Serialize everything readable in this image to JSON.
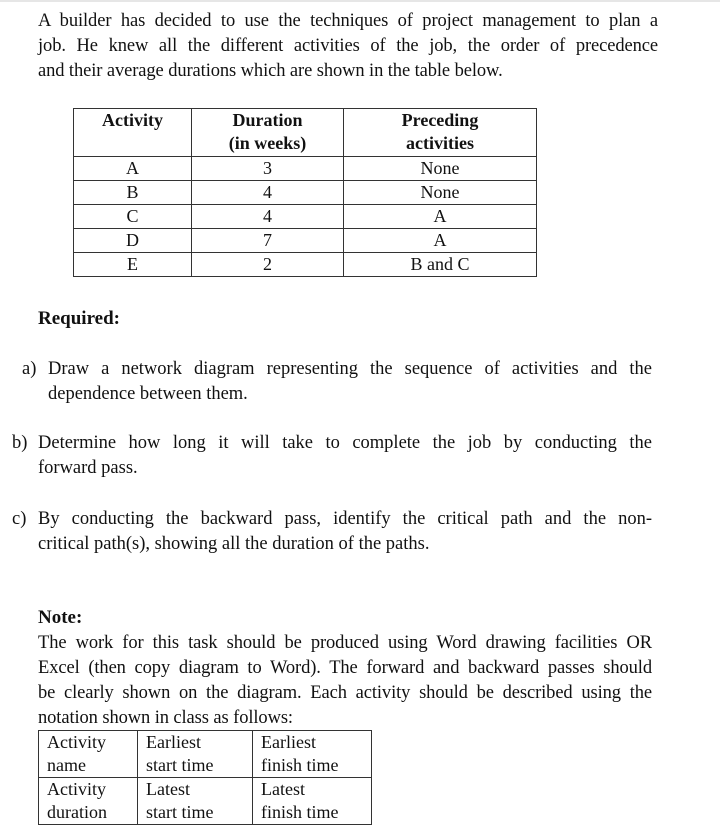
{
  "intro": {
    "lines": [
      "A builder has decided to use the techniques of project management to plan a",
      "job. He knew all the different activities of the job, the order of precedence",
      "and their average durations which are shown in the table below."
    ]
  },
  "activity_table": {
    "headers": [
      "Activity",
      "Duration (in weeks)",
      "Preceding activities"
    ],
    "header_lines": [
      [
        "Activity"
      ],
      [
        "Duration",
        "(in weeks)"
      ],
      [
        "Preceding",
        "activities"
      ]
    ],
    "rows": [
      {
        "activity": "A",
        "duration": "3",
        "preceding": "None"
      },
      {
        "activity": "B",
        "duration": "4",
        "preceding": "None"
      },
      {
        "activity": "C",
        "duration": "4",
        "preceding": "A"
      },
      {
        "activity": "D",
        "duration": "7",
        "preceding": "A"
      },
      {
        "activity": "E",
        "duration": "2",
        "preceding": "B and C"
      }
    ]
  },
  "required": {
    "heading": "Required:",
    "questions": [
      {
        "label": "a)",
        "lines": [
          "Draw a network diagram representing the sequence of activities and the",
          "dependence between them."
        ]
      },
      {
        "label": "b)",
        "lines": [
          "Determine how long it will take to complete the job by conducting the",
          "forward pass."
        ]
      },
      {
        "label": "c)",
        "lines": [
          "By conducting the backward pass, identify the critical path and the non-",
          "critical path(s), showing all the duration of the paths."
        ]
      }
    ]
  },
  "note": {
    "heading": "Note:",
    "lines": [
      "The work for this task should be produced using Word drawing facilities OR",
      "Excel (then copy diagram to Word). The forward and backward passes should",
      "be clearly shown on the diagram. Each activity should be described using the",
      "notation shown in class as follows:"
    ],
    "notation_table": [
      [
        [
          "Activity",
          "name"
        ],
        [
          "Earliest",
          "start time"
        ],
        [
          "Earliest",
          "finish time"
        ]
      ],
      [
        [
          "Activity",
          "duration"
        ],
        [
          "Latest",
          "start time"
        ],
        [
          "Latest",
          "finish time"
        ]
      ]
    ]
  }
}
